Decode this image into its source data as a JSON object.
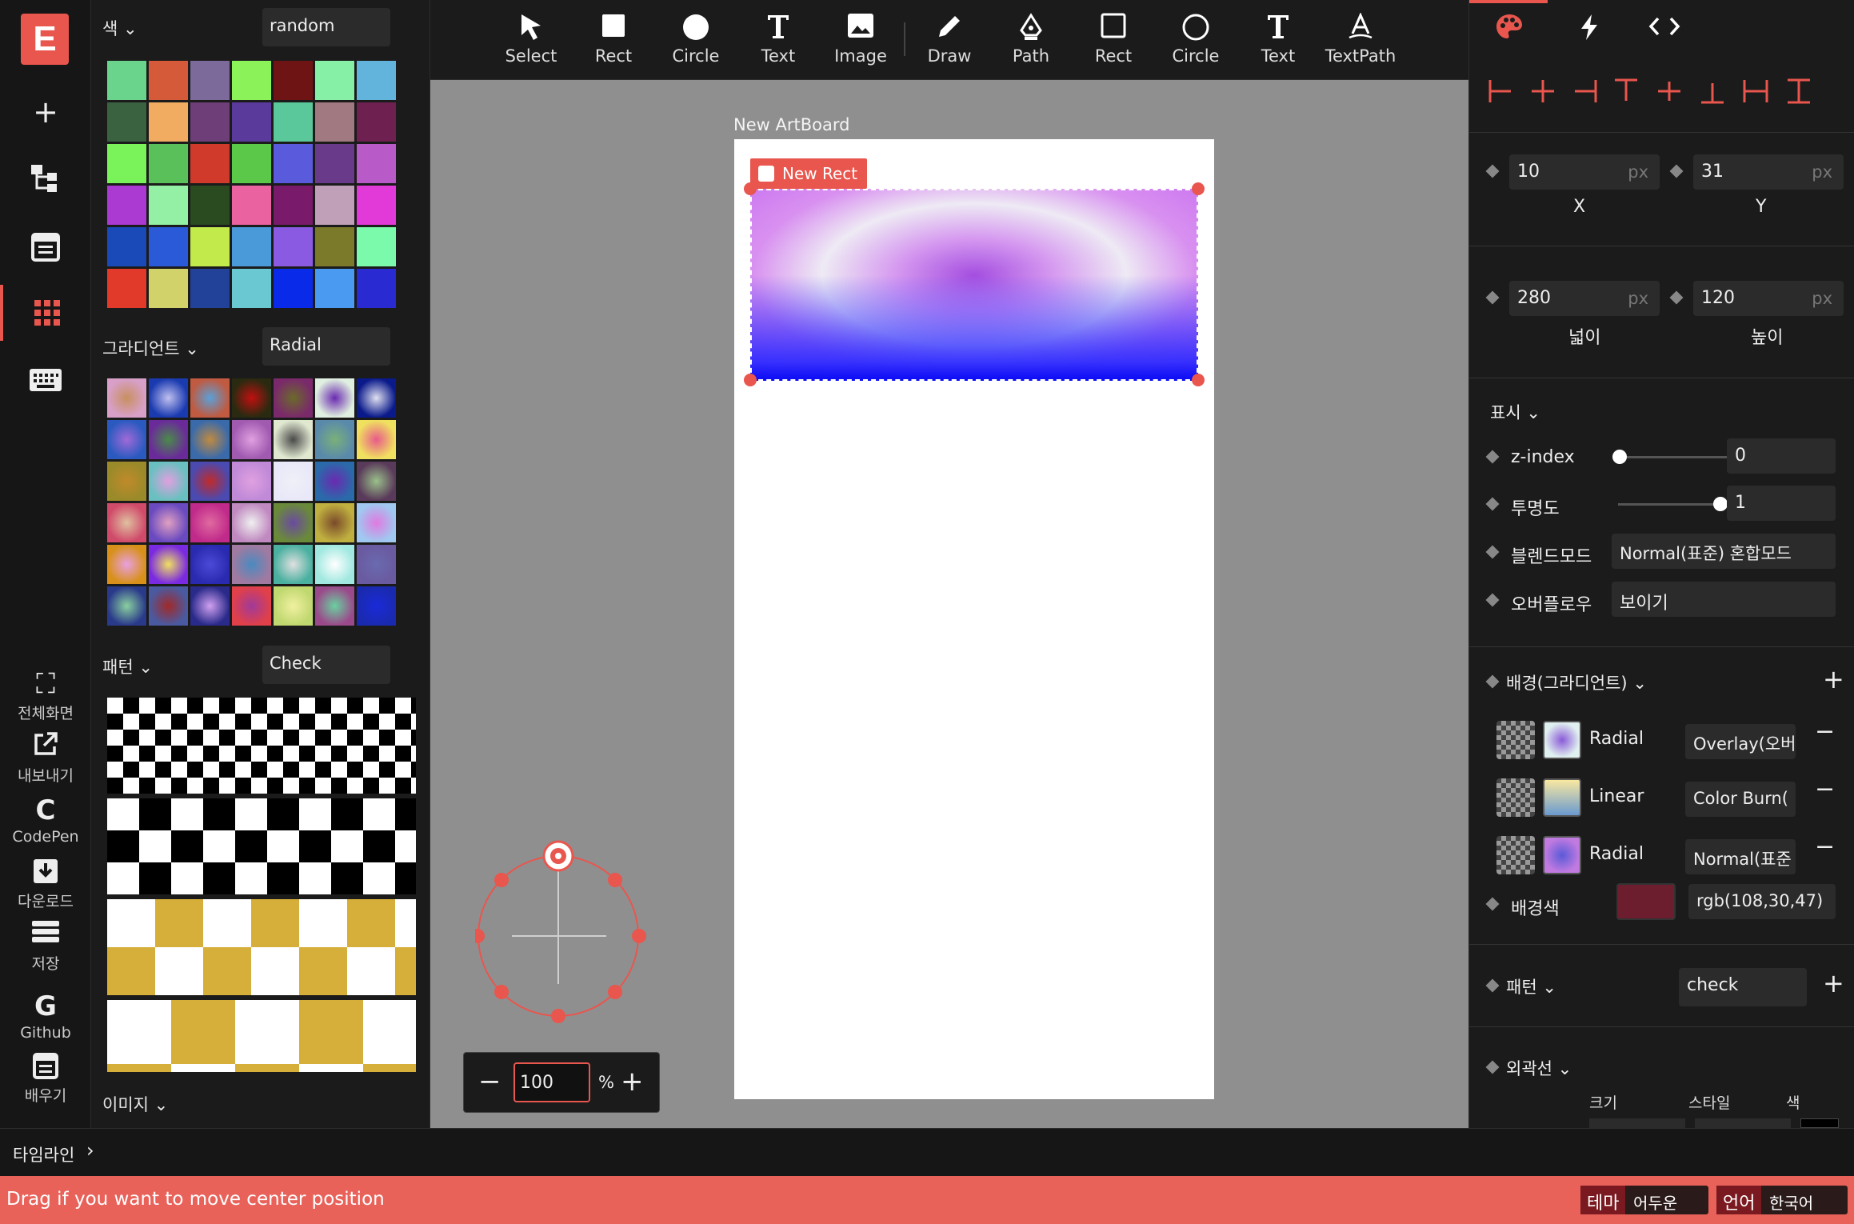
{
  "app": {
    "logo_letter": "E"
  },
  "rail": {
    "buttons": [
      {
        "label": "전체화면"
      },
      {
        "label": "내보내기"
      },
      {
        "label": "CodePen",
        "glyph": "C"
      },
      {
        "label": "다운로드"
      },
      {
        "label": "저장"
      },
      {
        "label": "Github",
        "glyph": "G"
      },
      {
        "label": "배우기"
      }
    ]
  },
  "library": {
    "colors": {
      "title": "색",
      "select": "random",
      "swatches": [
        "#6ad48c",
        "#d45a3a",
        "#7b6a9a",
        "#8cf25a",
        "#6e1414",
        "#86f0a6",
        "#62b4dc",
        "#3a6240",
        "#f2ac62",
        "#6e3e78",
        "#5a3a9a",
        "#5ac89a",
        "#a07a80",
        "#6e2050",
        "#7af25a",
        "#5ac05a",
        "#d03a2a",
        "#5cc84a",
        "#5a5adc",
        "#6a3a8a",
        "#b85ac8",
        "#aa3ad2",
        "#94f0a4",
        "#2a4a20",
        "#ea62a0",
        "#7a1a6a",
        "#c0a0b8",
        "#e23ad8",
        "#1a4ab8",
        "#2a5ad8",
        "#c2ea4a",
        "#4a9ada",
        "#8a5ae2",
        "#7a7a2a",
        "#7afaaa",
        "#e23a2a",
        "#d2d26a",
        "#22429a",
        "#6ac8d2",
        "#0a2aea",
        "#4a9af2",
        "#2a2ad2"
      ]
    },
    "gradients": {
      "title": "그라디언트",
      "select": "Radial",
      "swatches": [
        [
          "#d8a0c8",
          "#c89060"
        ],
        [
          "#1a3ab0",
          "#c0c0f0"
        ],
        [
          "#c05a40",
          "#5aa0d8"
        ],
        [
          "#2a2a10",
          "#c01010"
        ],
        [
          "#7a2a6a",
          "#6a6a2a"
        ],
        [
          "#e0f0e0",
          "#6a2ab0"
        ],
        [
          "#0a1a8a",
          "#e0e0f0"
        ],
        [
          "#2a5ac0",
          "#a06ad8"
        ],
        [
          "#6a2a9a",
          "#4a8a4a"
        ],
        [
          "#3a6aaa",
          "#c08a40"
        ],
        [
          "#a05ab0",
          "#e0a0e0"
        ],
        [
          "#e0e8d0",
          "#4a4a4a"
        ],
        [
          "#5a8aaa",
          "#7ab07a"
        ],
        [
          "#f0e060",
          "#e85a8a"
        ],
        [
          "#9a8a2a",
          "#c08a2a"
        ],
        [
          "#6ac0c0",
          "#e0a0e0"
        ],
        [
          "#4a4ab0",
          "#c02a2a"
        ],
        [
          "#c08ad8",
          "#e0a0e0"
        ],
        [
          "#e8e8f8",
          "#f0f0f8"
        ],
        [
          "#2a6aaa",
          "#6a2ab0"
        ],
        [
          "#5a3a5a",
          "#9ac08a"
        ],
        [
          "#d04a6a",
          "#e0c0a0"
        ],
        [
          "#6a4ac0",
          "#e0a0c0"
        ],
        [
          "#c02a8a",
          "#e06aa0"
        ],
        [
          "#c08ac0",
          "#f0f0f0"
        ],
        [
          "#6a8a3a",
          "#6a4aa0"
        ],
        [
          "#c0b040",
          "#7a4a2a"
        ],
        [
          "#a0c8f0",
          "#e07ae0"
        ],
        [
          "#d8901a",
          "#e8a0e0"
        ],
        [
          "#7a2ae0",
          "#f0e060"
        ],
        [
          "#2a2ab0",
          "#4a4ad8"
        ],
        [
          "#a07aa0",
          "#4a8ac0"
        ],
        [
          "#4ab0a0",
          "#e0e0e0"
        ],
        [
          "#a0e8e0",
          "#ffffff"
        ],
        [
          "#6a5aa0",
          "#6a6ab0"
        ],
        [
          "#2a3a8a",
          "#8ad0a0"
        ],
        [
          "#4a5aa0",
          "#a02a2a"
        ],
        [
          "#2a2a8a",
          "#d0a0f0"
        ],
        [
          "#e0404a",
          "#a03a9a"
        ],
        [
          "#c0d870",
          "#f0f0a0"
        ],
        [
          "#9a4a8a",
          "#6ad0a0"
        ],
        [
          "#1a2ab0",
          "#1a2ad8"
        ]
      ]
    },
    "patterns": {
      "title": "패턴",
      "select": "Check"
    },
    "images": {
      "title": "이미지"
    }
  },
  "toolbar": {
    "tools": [
      {
        "label": "Select",
        "icon": "cursor-icon"
      },
      {
        "label": "Rect",
        "icon": "rect-filled-icon"
      },
      {
        "label": "Circle",
        "icon": "circle-filled-icon"
      },
      {
        "label": "Text",
        "icon": "text-icon"
      },
      {
        "label": "Image",
        "icon": "image-icon"
      },
      {
        "label": "Draw",
        "icon": "pencil-icon"
      },
      {
        "label": "Path",
        "icon": "pen-nib-icon"
      },
      {
        "label": "Rect",
        "icon": "rect-outline-icon"
      },
      {
        "label": "Circle",
        "icon": "circle-outline-icon"
      },
      {
        "label": "Text",
        "icon": "text-outline-icon"
      },
      {
        "label": "TextPath",
        "icon": "text-path-icon"
      }
    ]
  },
  "canvas": {
    "artboard_title": "New ArtBoard",
    "selected_label": "New Rect",
    "zoom_value": "100",
    "zoom_unit": "%"
  },
  "inspector": {
    "tabs": [
      "palette-icon",
      "lightning-icon",
      "code-icon"
    ],
    "x": {
      "value": "10",
      "unit": "px",
      "label": "X"
    },
    "y": {
      "value": "31",
      "unit": "px",
      "label": "Y"
    },
    "w": {
      "value": "280",
      "unit": "px",
      "label": "넓이"
    },
    "h": {
      "value": "120",
      "unit": "px",
      "label": "높이"
    },
    "display": {
      "title": "표시",
      "zindex": {
        "label": "z-index",
        "value": "0",
        "level": 0
      },
      "opacity": {
        "label": "투명도",
        "value": "1",
        "level": 1
      },
      "blend": {
        "label": "블렌드모드",
        "value": "Normal(표준) 혼합모드"
      },
      "overflow": {
        "label": "오버플로우",
        "value": "보이기"
      }
    },
    "background": {
      "title": "배경(그라디언트)",
      "layers": [
        {
          "type": "Radial",
          "blend": "Overlay(오버",
          "colors": [
            "#8a5ad8",
            "#e0f0f0"
          ]
        },
        {
          "type": "Linear",
          "blend": "Color Burn(",
          "colors": [
            "#f8e8a0",
            "#6a9ad0"
          ]
        },
        {
          "type": "Radial",
          "blend": "Normal(표준",
          "colors": [
            "#5a5ad8",
            "#c07ae0"
          ]
        }
      ],
      "color_label": "배경색",
      "color_value": "rgb(108,30,47)",
      "color_hex": "#6c1e2f"
    },
    "pattern": {
      "title": "패턴",
      "value": "check"
    },
    "border": {
      "title": "외곽선",
      "cols": [
        "크기",
        "스타일",
        "색"
      ]
    }
  },
  "timeline": {
    "label": "타임라인"
  },
  "status": {
    "message": "Drag if you want to move center position",
    "theme_label": "테마",
    "theme_value": "어두운",
    "lang_label": "언어",
    "lang_value": "한국어"
  }
}
